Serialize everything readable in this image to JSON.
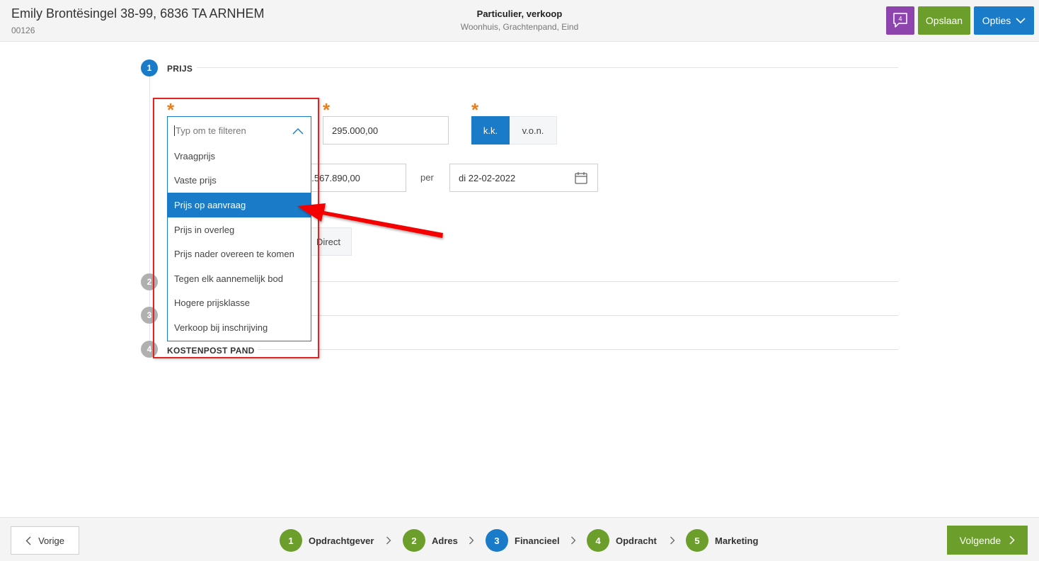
{
  "header": {
    "address": "Emily Brontësingel 38-99, 6836 TA ARNHEM",
    "id": "00126",
    "type": "Particulier, verkoop",
    "subtype": "Woonhuis, Grachtenpand, Eind",
    "chat_count": "4",
    "save_label": "Opslaan",
    "options_label": "Opties"
  },
  "sections": [
    {
      "number": "1",
      "label": "PRIJS"
    },
    {
      "number": "2",
      "label": ""
    },
    {
      "number": "3",
      "label": ""
    },
    {
      "number": "4",
      "label": "KOSTENPOST PAND"
    }
  ],
  "form": {
    "filter_placeholder": "Typ om te filteren",
    "price_value": "295.000,00",
    "kk_label": "k.k.",
    "von_label": "v.o.n.",
    "second_price_value": "4.567.890,00",
    "per_label": "per",
    "date_value": "di 22-02-2022",
    "direct_label": "Direct"
  },
  "dropdown_options": [
    {
      "label": "Vraagprijs"
    },
    {
      "label": "Vaste prijs"
    },
    {
      "label": "Prijs op aanvraag",
      "selected": true
    },
    {
      "label": "Prijs in overleg"
    },
    {
      "label": "Prijs nader overeen te komen"
    },
    {
      "label": "Tegen elk aannemelijk bod"
    },
    {
      "label": "Hogere prijsklasse"
    },
    {
      "label": "Verkoop bij inschrijving"
    }
  ],
  "footer": {
    "prev_label": "Vorige",
    "next_label": "Volgende",
    "steps": [
      {
        "number": "1",
        "label": "Opdrachtgever",
        "state": "done"
      },
      {
        "number": "2",
        "label": "Adres",
        "state": "done"
      },
      {
        "number": "3",
        "label": "Financieel",
        "state": "active"
      },
      {
        "number": "4",
        "label": "Opdracht",
        "state": "done"
      },
      {
        "number": "5",
        "label": "Marketing",
        "state": "done"
      }
    ]
  },
  "colors": {
    "primary_blue": "#1a7bc9",
    "green": "#6b9e2a",
    "purple": "#8e44ad",
    "required_orange": "#e67e22",
    "annotation_red": "#e02424",
    "inactive_gray": "#b0b0b0"
  },
  "icons": {
    "chat": "chat-bubble-icon",
    "options_chevron": "chevron-down-icon",
    "dropdown_chevron": "chevron-up-icon",
    "calendar": "calendar-icon",
    "prev_chevron": "chevron-left-icon",
    "next_chevron": "chevron-right-icon",
    "step_separator": "chevron-right-icon",
    "annotation": "red-arrow-annotation"
  }
}
